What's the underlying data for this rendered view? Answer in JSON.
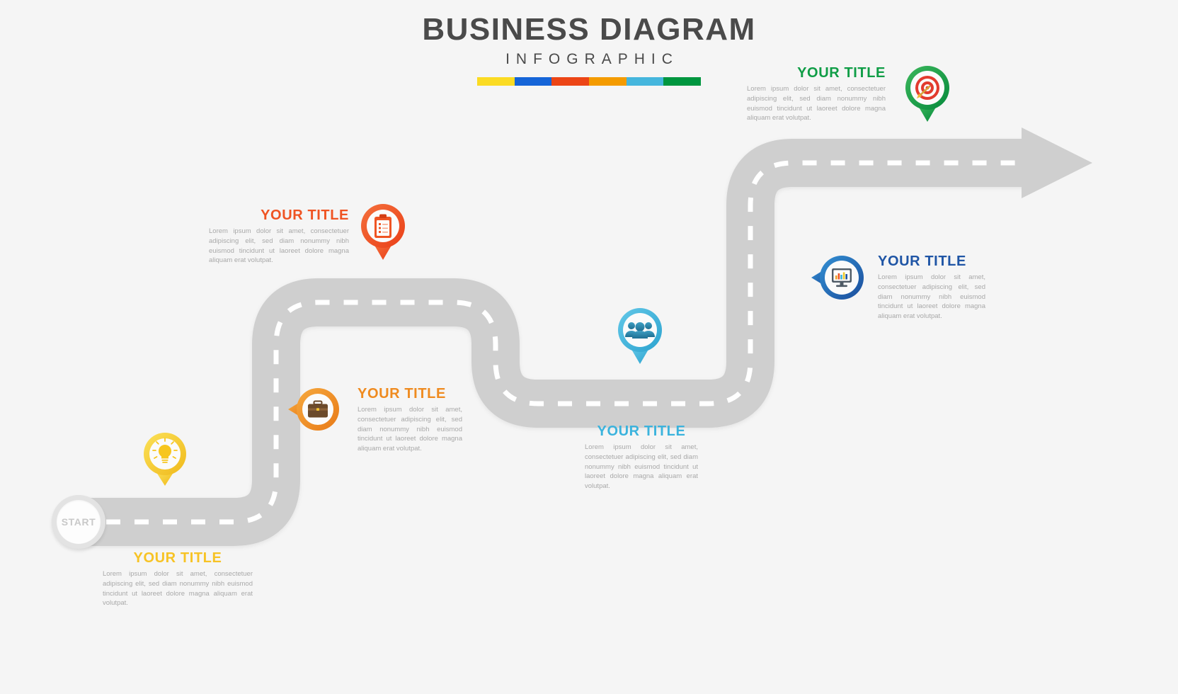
{
  "header": {
    "title": "BUSINESS DIAGRAM",
    "subtitle": "INFOGRAPHIC",
    "bar_colors": [
      "#fbdb23",
      "#1565d8",
      "#ec4516",
      "#f49b00",
      "#45b6dd",
      "#00963f"
    ]
  },
  "start": {
    "label": "START"
  },
  "body_text": "Lorem ipsum dolor sit amet, consectetuer adipiscing elit, sed diam nonummy nibh euismod tincidunt ut laoreet dolore magna aliquam erat volutpat.",
  "steps": [
    {
      "id": "step-1",
      "title": "YOUR TITLE",
      "body": "Lorem ipsum dolor sit amet, consectetuer adipiscing elit, sed diam nonummy nibh euismod tincidunt ut laoreet dolore magna aliquam erat volutpat.",
      "color": "#f7c325",
      "color_light": "#fbe158",
      "icon": "lightbulb-icon",
      "pin_direction": "down"
    },
    {
      "id": "step-2",
      "title": "YOUR TITLE",
      "body": "Lorem ipsum dolor sit amet, consectetuer adipiscing elit, sed diam nonummy nibh euismod tincidunt ut laoreet dolore magna aliquam erat volutpat.",
      "color": "#ef8b20",
      "color_light": "#f5a93e",
      "icon": "briefcase-icon",
      "pin_direction": "left"
    },
    {
      "id": "step-3",
      "title": "YOUR TITLE",
      "body": "Lorem ipsum dolor sit amet, consectetuer adipiscing elit, sed diam nonummy nibh euismod tincidunt ut laoreet dolore magna aliquam erat volutpat.",
      "color": "#ef5423",
      "color_light": "#f3713e",
      "icon": "clipboard-icon",
      "pin_direction": "down"
    },
    {
      "id": "step-4",
      "title": "YOUR TITLE",
      "body": "Lorem ipsum dolor sit amet, consectetuer adipiscing elit, sed diam nonummy nibh euismod tincidunt ut laoreet dolore magna aliquam erat volutpat.",
      "color": "#3bb3dd",
      "color_light": "#62c6e6",
      "icon": "people-icon",
      "pin_direction": "down"
    },
    {
      "id": "step-5",
      "title": "YOUR TITLE",
      "body": "Lorem ipsum dolor sit amet, consectetuer adipiscing elit, sed diam nonummy nibh euismod tincidunt ut laoreet dolore magna aliquam erat volutpat.",
      "color": "#1f55a5",
      "color_light": "#2f8ed0",
      "icon": "monitor-chart-icon",
      "pin_direction": "left"
    },
    {
      "id": "step-6",
      "title": "YOUR TITLE",
      "body": "Lorem ipsum dolor sit amet, consectetuer adipiscing elit, sed diam nonummy nibh euismod tincidunt ut laoreet dolore magna aliquam erat volutpat.",
      "color": "#0f9d46",
      "color_light": "#3bb55c",
      "icon": "target-icon",
      "pin_direction": "down"
    }
  ],
  "road": {
    "color": "#cfcfcf",
    "dash_color": "#ffffff"
  }
}
